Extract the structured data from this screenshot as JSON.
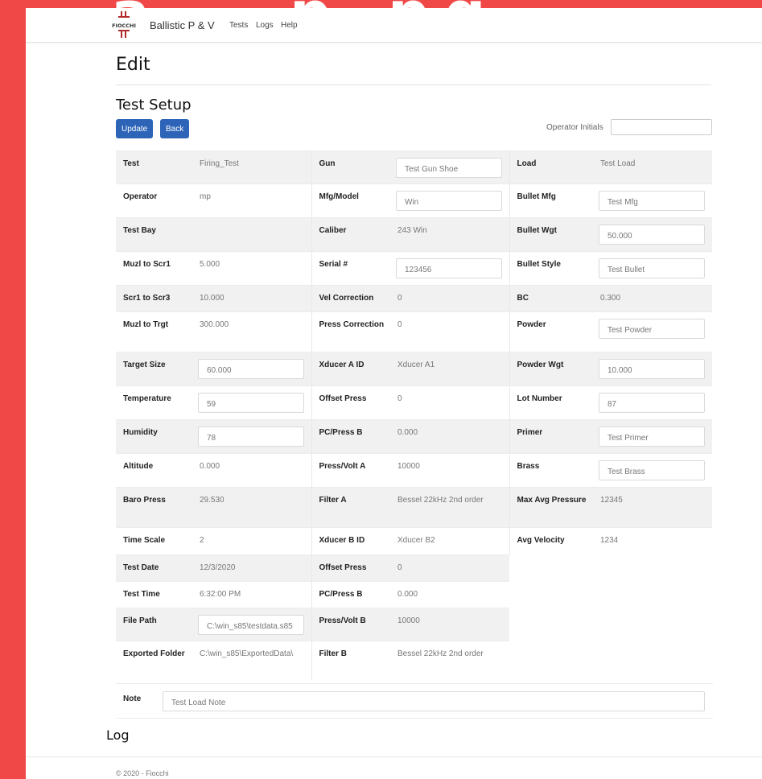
{
  "navbar": {
    "logo_text": "FIOCCHI",
    "brand": "Ballistic P & V",
    "links": [
      "Tests",
      "Logs",
      "Help"
    ]
  },
  "page_title": "Edit",
  "section_title": "Test Setup",
  "buttons": {
    "update": "Update",
    "back": "Back"
  },
  "operator_initials": {
    "label": "Operator Initials",
    "value": ""
  },
  "rows": [
    {
      "c1": {
        "label": "Test",
        "value": "Firing_Test"
      },
      "c2": {
        "label": "Gun",
        "value": "Test Gun Shoe",
        "input": true
      },
      "c3": {
        "label": "Load",
        "value": "Test Load"
      }
    },
    {
      "c1": {
        "label": "Operator",
        "value": "mp"
      },
      "c2": {
        "label": "Mfg/Model",
        "value": "Win",
        "input": true
      },
      "c3": {
        "label": "Bullet Mfg",
        "value": "Test Mfg",
        "input": true
      }
    },
    {
      "c1": {
        "label": "Test Bay",
        "value": ""
      },
      "c2": {
        "label": "Caliber",
        "value": "243 Win"
      },
      "c3": {
        "label": "Bullet Wgt",
        "value": "50.000",
        "input": true
      }
    },
    {
      "c1": {
        "label": "Muzl to Scr1",
        "value": "5.000"
      },
      "c2": {
        "label": "Serial #",
        "value": "123456",
        "input": true
      },
      "c3": {
        "label": "Bullet Style",
        "value": "Test Bullet",
        "input": true
      }
    },
    {
      "c1": {
        "label": "Scr1 to Scr3",
        "value": "10.000"
      },
      "c2": {
        "label": "Vel Correction",
        "value": "0"
      },
      "c3": {
        "label": "BC",
        "value": "0.300"
      }
    },
    {
      "c1": {
        "label": "Muzl to Trgt",
        "value": "300.000"
      },
      "c2": {
        "label": "Press Correction",
        "value": "0"
      },
      "c3": {
        "label": "Powder",
        "value": "Test Powder",
        "input": true
      }
    },
    {
      "c1": {
        "label": "Target Size",
        "value": "60.000",
        "input": true
      },
      "c2": {
        "label": "Xducer A ID",
        "value": "Xducer A1"
      },
      "c3": {
        "label": "Powder Wgt",
        "value": "10.000",
        "input": true
      }
    },
    {
      "c1": {
        "label": "Temperature",
        "value": "59",
        "input": true
      },
      "c2": {
        "label": "Offset Press",
        "value": "0"
      },
      "c3": {
        "label": "Lot Number",
        "value": "87",
        "input": true
      }
    },
    {
      "c1": {
        "label": "Humidity",
        "value": "78",
        "input": true
      },
      "c2": {
        "label": "PC/Press B",
        "value": "0.000"
      },
      "c3": {
        "label": "Primer",
        "value": "Test Primer",
        "input": true
      }
    },
    {
      "c1": {
        "label": "Altitude",
        "value": "0.000"
      },
      "c2": {
        "label": "Press/Volt A",
        "value": "10000"
      },
      "c3": {
        "label": "Brass",
        "value": "Test Brass",
        "input": true
      }
    },
    {
      "c1": {
        "label": "Baro Press",
        "value": "29.530"
      },
      "c2": {
        "label": "Filter A",
        "value": "Bessel 22kHz 2nd order"
      },
      "c3": {
        "label": "Max Avg Pressure",
        "value": "12345"
      }
    },
    {
      "c1": {
        "label": "Time Scale",
        "value": "2"
      },
      "c2": {
        "label": "Xducer B ID",
        "value": "Xducer B2"
      },
      "c3": {
        "label": "Avg Velocity",
        "value": "1234"
      }
    },
    {
      "c1": {
        "label": "Test Date",
        "value": "12/3/2020"
      },
      "c2": {
        "label": "Offset Press",
        "value": "0"
      },
      "c3": null
    },
    {
      "c1": {
        "label": "Test Time",
        "value": "6:32:00 PM"
      },
      "c2": {
        "label": "PC/Press B",
        "value": "0.000"
      },
      "c3": null
    },
    {
      "c1": {
        "label": "File Path",
        "value": "C:\\win_s85\\testdata.s85",
        "input": true
      },
      "c2": {
        "label": "Press/Volt B",
        "value": "10000"
      },
      "c3": null
    },
    {
      "c1": {
        "label": "Exported Folder",
        "value": "C:\\win_s85\\ExportedData\\"
      },
      "c2": {
        "label": "Filter B",
        "value": "Bessel 22kHz 2nd order"
      },
      "c3": null
    }
  ],
  "note": {
    "label": "Note",
    "value": "Test Load Note"
  },
  "log_title": "Log",
  "footer": "© 2020 - Fiocchi",
  "colors": {
    "background": "#f04747",
    "primary_button": "#2d64b8",
    "logo": "#b32b2b"
  }
}
